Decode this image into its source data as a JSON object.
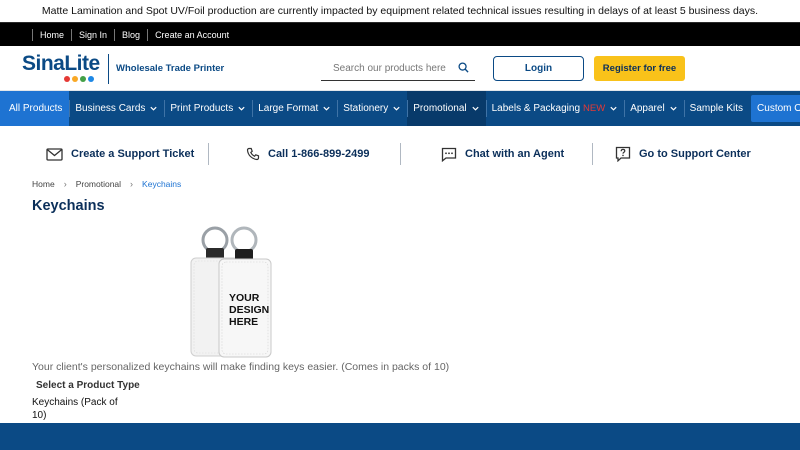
{
  "notice": "Matte Lamination and Spot UV/Foil production are currently impacted by equipment related technical issues resulting in delays of at least 5 business days.",
  "top_links": [
    "Home",
    "Sign In",
    "Blog",
    "Create an Account"
  ],
  "brand": {
    "name": "SinaLite",
    "tagline": "Wholesale Trade Printer",
    "dot_colors": [
      "#e53935",
      "#f9a825",
      "#43a047",
      "#1e88e5"
    ]
  },
  "search": {
    "placeholder": "Search our products here",
    "icon": "search-icon"
  },
  "header_buttons": {
    "login": "Login",
    "register": "Register for free"
  },
  "nav": {
    "all_products": "All Products",
    "items": [
      "Business Cards",
      "Print Products",
      "Large Format",
      "Stationery",
      "Promotional",
      "Labels & Packaging",
      "Apparel",
      "Sample Kits"
    ],
    "new_badge": "NEW",
    "custom_order": "Custom Order"
  },
  "support": {
    "ticket": "Create a Support Ticket",
    "call": "Call 1-866-899-2499",
    "chat": "Chat with an Agent",
    "center": "Go to Support Center"
  },
  "breadcrumb": [
    "Home",
    "Promotional",
    "Keychains"
  ],
  "page_title": "Keychains",
  "product": {
    "image_text": [
      "YOUR",
      "DESIGN",
      "HERE"
    ],
    "description": "Your client's personalized keychains will make finding keys easier. (Comes in packs of 10)",
    "select_label": "Select a Product Type",
    "option": "Keychains (Pack of 10)"
  },
  "colors": {
    "brand_blue": "#0b4a85",
    "accent_blue": "#1e73d2",
    "register_yellow": "#f9c21a"
  }
}
